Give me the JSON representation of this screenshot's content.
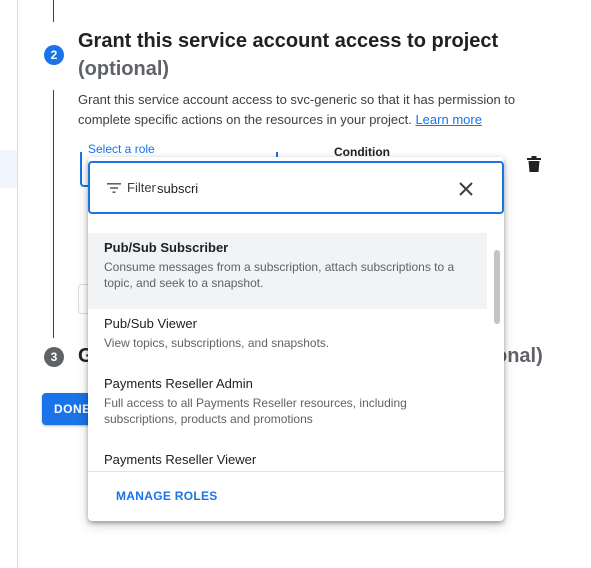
{
  "step2": {
    "number": "2",
    "title": "Grant this service account access to project",
    "optional": "(optional)",
    "description_prefix": "Grant this service account access to svc-generic so that it has permission to complete specific actions on the resources in your project. ",
    "learn_more": "Learn more",
    "role_label": "Select a role",
    "condition_label": "Condition"
  },
  "step3": {
    "number": "3",
    "title_start": "G",
    "title_end": "onal)"
  },
  "done_button": "DONE",
  "dropdown": {
    "filter_label": "Filter",
    "filter_value": "subscri",
    "items": [
      {
        "title": "Pub/Sub Subscriber",
        "description": "Consume messages from a subscription, attach subscriptions to a topic, and seek to a snapshot."
      },
      {
        "title": "Pub/Sub Viewer",
        "description": "View topics, subscriptions, and snapshots."
      },
      {
        "title": "Payments Reseller Admin",
        "description": "Full access to all Payments Reseller resources, including subscriptions, products and promotions"
      },
      {
        "title": "Payments Reseller Viewer",
        "description": ""
      }
    ],
    "manage_roles": "MANAGE ROLES"
  },
  "colors": {
    "accent": "#1a73e8",
    "step_inactive": "#5f6368"
  },
  "icons": [
    "filter-icon",
    "close-icon",
    "trash-icon"
  ]
}
